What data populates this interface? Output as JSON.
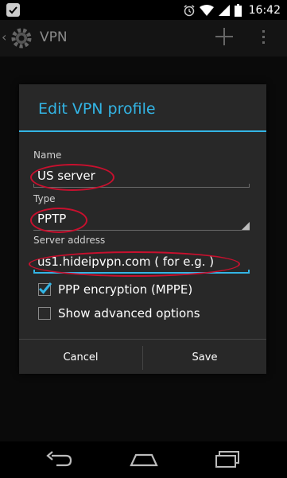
{
  "status_bar": {
    "time": "16:42"
  },
  "action_bar": {
    "title": "VPN"
  },
  "dialog": {
    "title": "Edit VPN profile",
    "name_label": "Name",
    "name_value": "US server",
    "type_label": "Type",
    "type_value": "PPTP",
    "server_label": "Server address",
    "server_value": "us1.hideipvpn.com ( for e.g. )",
    "ppp_label": "PPP encryption (MPPE)",
    "ppp_checked": true,
    "advanced_label": "Show advanced options",
    "advanced_checked": false,
    "cancel_label": "Cancel",
    "save_label": "Save"
  },
  "colors": {
    "accent": "#33b5e5",
    "annotation": "#c8102e",
    "dialog_bg": "#282828"
  }
}
